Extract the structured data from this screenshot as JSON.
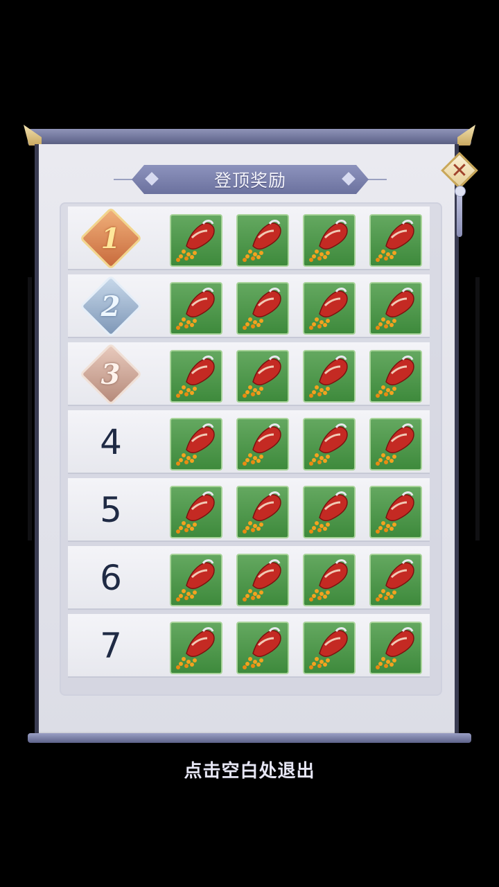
{
  "title": "登顶奖励",
  "close_icon": "close-icon",
  "ranks": [
    {
      "rank": "1",
      "style": "medal-gold",
      "items": [
        "red-pouch-icon",
        "red-pouch-icon",
        "red-pouch-icon",
        "red-pouch-icon"
      ]
    },
    {
      "rank": "2",
      "style": "medal-silver",
      "items": [
        "red-pouch-icon",
        "red-pouch-icon",
        "red-pouch-icon",
        "red-pouch-icon"
      ]
    },
    {
      "rank": "3",
      "style": "medal-bronze",
      "items": [
        "red-pouch-icon",
        "red-pouch-icon",
        "red-pouch-icon",
        "red-pouch-icon"
      ]
    },
    {
      "rank": "4",
      "style": "plain",
      "items": [
        "red-pouch-icon",
        "red-pouch-icon",
        "red-pouch-icon",
        "red-pouch-icon"
      ]
    },
    {
      "rank": "5",
      "style": "plain",
      "items": [
        "red-pouch-icon",
        "red-pouch-icon",
        "red-pouch-icon",
        "red-pouch-icon"
      ]
    },
    {
      "rank": "6",
      "style": "plain",
      "items": [
        "red-pouch-icon",
        "red-pouch-icon",
        "red-pouch-icon",
        "red-pouch-icon"
      ]
    },
    {
      "rank": "7",
      "style": "plain",
      "items": [
        "red-pouch-icon",
        "red-pouch-icon",
        "red-pouch-icon",
        "red-pouch-icon"
      ]
    }
  ],
  "colors": {
    "item_bg": "#4f9a4c",
    "rank_text": "#1f2a44",
    "banner": "#7b81ad"
  },
  "exit_hint": "点击空白处退出"
}
